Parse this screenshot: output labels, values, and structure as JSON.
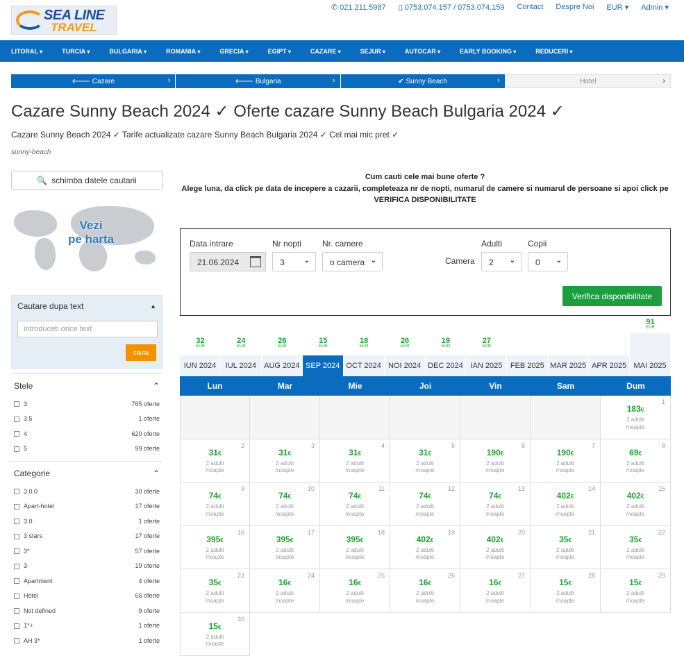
{
  "header": {
    "logo_line1": "SEA LINE",
    "logo_line2": "TRAVEL",
    "phone1": "021.211.5987",
    "phone2": "0753.074.157 / 0753.074.159",
    "contact": "Contact",
    "about": "Despre Noi",
    "currency": "EUR ▾",
    "admin": "Admin ▾"
  },
  "nav": [
    "LITORAL",
    "TURCIA",
    "BULGARIA",
    "ROMANIA",
    "GRECIA",
    "EGIPT",
    "CAZARE",
    "SEJUR",
    "AUTOCAR",
    "EARLY BOOKING",
    "REDUCERI"
  ],
  "breadcrumbs": [
    {
      "label": "🡐 Cazare"
    },
    {
      "label": "🡐 Bulgaria"
    },
    {
      "label": "✔ Sunny Beach"
    },
    {
      "label": "Hotel"
    }
  ],
  "page": {
    "title": "Cazare Sunny Beach 2024 ✓ Oferte cazare Sunny Beach Bulgaria 2024 ✓",
    "subtitle": "Cazare Sunny Beach 2024 ✓ Tarife actualizate cazare Sunny Beach Bulgaria 2024 ✓ Cel mai mic pret ✓",
    "slug": "sunny-beach"
  },
  "sidebar": {
    "change_search": "schimba datele cautarii",
    "map_text_1": "Vezi",
    "map_text_2": "pe harta",
    "text_search_title": "Cautare dupa text",
    "text_search_placeholder": "introduceti orice text",
    "text_search_button": "cauta",
    "stars_title": "Stele",
    "stars": [
      {
        "label": "3",
        "count": "765 oferte"
      },
      {
        "label": "3.5",
        "count": "1 oferte"
      },
      {
        "label": "4",
        "count": "620 oferte"
      },
      {
        "label": "5",
        "count": "99 oferte"
      }
    ],
    "category_title": "Categorie",
    "categories": [
      {
        "label": "3.0.0",
        "count": "30 oferte"
      },
      {
        "label": "Apart-hotel",
        "count": "17 oferte"
      },
      {
        "label": "3.0",
        "count": "1 oferte"
      },
      {
        "label": "3 stars",
        "count": "17 oferte"
      },
      {
        "label": "3*",
        "count": "57 oferte"
      },
      {
        "label": "3",
        "count": "19 oferte"
      },
      {
        "label": "Apartment",
        "count": "4 oferte"
      },
      {
        "label": "Hotel",
        "count": "66 oferte"
      },
      {
        "label": "Not defined",
        "count": "9 oferte"
      },
      {
        "label": "1*+",
        "count": "1 oferte"
      },
      {
        "label": "AH 3*",
        "count": "1 oferte"
      }
    ]
  },
  "intro": {
    "line1": "Cum cauti cele mai bune oferte ?",
    "line2": "Alege luna, da click pe data de incepere a cazarii, completeaza nr de nopti, numarul de camere si numarul de persoane si apoi click pe",
    "line2_bold": "VERIFICA DISPONIBILITATE"
  },
  "form": {
    "date_label": "Data intrare",
    "date_value": "21.06.2024",
    "nights_label": "Nr nopti",
    "nights_value": "3",
    "rooms_label": "Nr. camere",
    "rooms_value": "o camera",
    "room_label": "Camera",
    "adults_label": "Adulti",
    "adults_value": "2",
    "children_label": "Copii",
    "children_value": "0",
    "verify_button": "Verifica disponibilitate"
  },
  "months": [
    {
      "label": "IUN 2024",
      "price": "32",
      "cur": "EUR"
    },
    {
      "label": "IUL 2024",
      "price": "24",
      "cur": "EUR"
    },
    {
      "label": "AUG 2024",
      "price": "26",
      "cur": "EUR"
    },
    {
      "label": "SEP 2024",
      "price": "15",
      "cur": "EUR",
      "active": true
    },
    {
      "label": "OCT 2024",
      "price": "18",
      "cur": "EUR"
    },
    {
      "label": "NOI 2024",
      "price": "26",
      "cur": "EUR"
    },
    {
      "label": "DEC 2024",
      "price": "19",
      "cur": "EUR"
    },
    {
      "label": "IAN 2025",
      "price": "27",
      "cur": "EUR"
    },
    {
      "label": "FEB 2025",
      "price": "",
      "cur": ""
    },
    {
      "label": "MAR 2025",
      "price": "",
      "cur": ""
    },
    {
      "label": "APR 2025",
      "price": "",
      "cur": ""
    },
    {
      "label": "MAI 2025",
      "price": "91",
      "cur": "EUR",
      "tall": true
    }
  ],
  "weekdays": [
    "Lun",
    "Mar",
    "Mie",
    "Joi",
    "Vin",
    "Sam",
    "Dum"
  ],
  "calendar": {
    "currency_symbol": "€",
    "note_line1": "2 adulti",
    "note_line2": "/noapte",
    "days": [
      {
        "day": "",
        "price": ""
      },
      {
        "day": "",
        "price": ""
      },
      {
        "day": "",
        "price": ""
      },
      {
        "day": "",
        "price": ""
      },
      {
        "day": "",
        "price": ""
      },
      {
        "day": "",
        "price": ""
      },
      {
        "day": "1",
        "price": "183"
      },
      {
        "day": "2",
        "price": "31"
      },
      {
        "day": "3",
        "price": "31"
      },
      {
        "day": "4",
        "price": "31"
      },
      {
        "day": "5",
        "price": "31"
      },
      {
        "day": "6",
        "price": "190"
      },
      {
        "day": "7",
        "price": "190"
      },
      {
        "day": "8",
        "price": "69"
      },
      {
        "day": "9",
        "price": "74"
      },
      {
        "day": "10",
        "price": "74"
      },
      {
        "day": "11",
        "price": "74"
      },
      {
        "day": "12",
        "price": "74"
      },
      {
        "day": "13",
        "price": "74"
      },
      {
        "day": "14",
        "price": "402"
      },
      {
        "day": "15",
        "price": "402"
      },
      {
        "day": "16",
        "price": "395"
      },
      {
        "day": "17",
        "price": "395"
      },
      {
        "day": "18",
        "price": "395"
      },
      {
        "day": "19",
        "price": "402"
      },
      {
        "day": "20",
        "price": "402"
      },
      {
        "day": "21",
        "price": "35"
      },
      {
        "day": "22",
        "price": "35"
      },
      {
        "day": "23",
        "price": "35"
      },
      {
        "day": "24",
        "price": "16"
      },
      {
        "day": "25",
        "price": "16"
      },
      {
        "day": "26",
        "price": "16"
      },
      {
        "day": "27",
        "price": "16"
      },
      {
        "day": "28",
        "price": "15"
      },
      {
        "day": "29",
        "price": "15"
      },
      {
        "day": "30",
        "price": "15"
      }
    ]
  }
}
